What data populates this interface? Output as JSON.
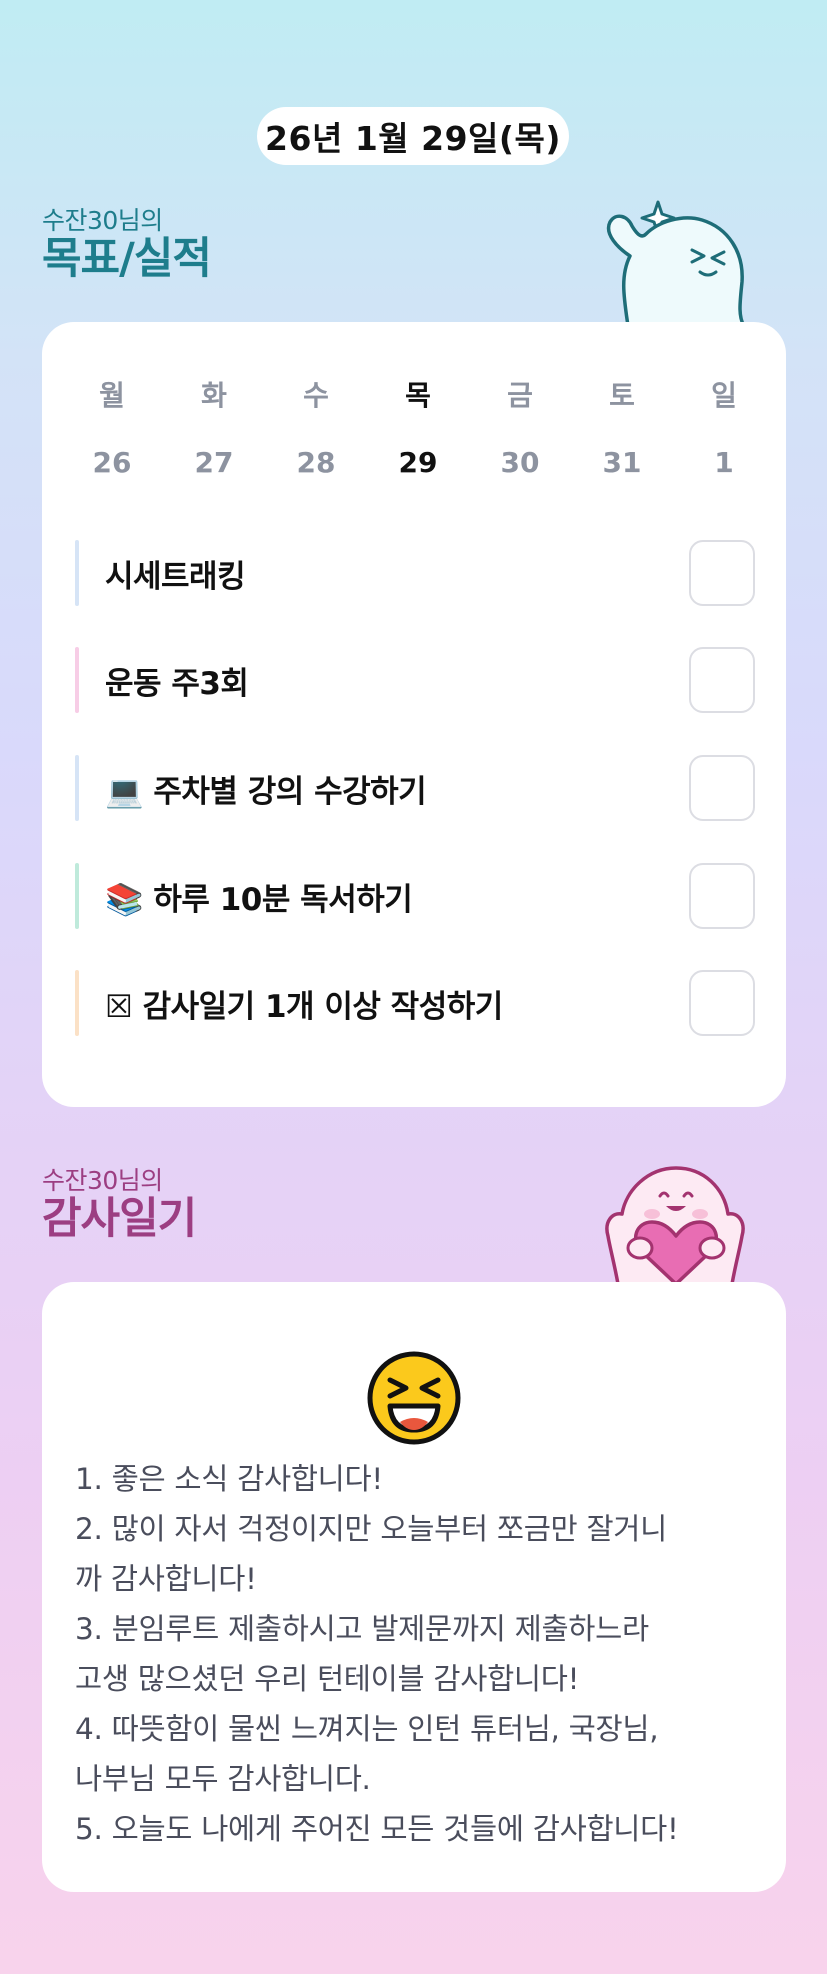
{
  "date": "26년 1월 29일(목)",
  "goals_section": {
    "subtitle": "수잔30님의",
    "title": "목표/실적"
  },
  "calendar": {
    "weekdays": [
      "월",
      "화",
      "수",
      "목",
      "금",
      "토",
      "일"
    ],
    "dates": [
      "26",
      "27",
      "28",
      "29",
      "30",
      "31",
      "1"
    ],
    "active_index": 3
  },
  "goals": [
    {
      "label": "시세트래킹",
      "bar_color": "#d6e4f6",
      "checked": false
    },
    {
      "label": "운동 주3회",
      "bar_color": "#f7cde6",
      "checked": false
    },
    {
      "label": "💻 주차별 강의 수강하기",
      "bar_color": "#d6e4f6",
      "checked": false
    },
    {
      "label": "📚 하루 10분 독서하기",
      "bar_color": "#bfeadb",
      "checked": false
    },
    {
      "label": "☒ 감사일기 1개 이상 작성하기",
      "bar_color": "#fbe1c6",
      "checked": false
    }
  ],
  "gratitude_section": {
    "subtitle": "수잔30님의",
    "title": "감사일기"
  },
  "gratitude": {
    "emoji": "laughing-face",
    "lines": [
      "1. 좋은 소식 감사합니다!",
      "2. 많이 자서 걱정이지만 오늘부터 쪼금만 잘거니",
      "까 감사합니다!",
      "3. 분임루트 제출하시고 발제문까지 제출하느라",
      "고생 많으셨던 우리 턴테이블 감사합니다!",
      "4. 따뜻함이 물씬 느껴지는 인턴 튜터님, 국장님,",
      "나부님 모두 감사합니다.",
      "5. 오늘도 나에게 주어진 모든 것들에 감사합니다!"
    ]
  },
  "colors": {
    "goal_title": "#1e7d8c",
    "gratitude_title": "#9c3e82"
  }
}
